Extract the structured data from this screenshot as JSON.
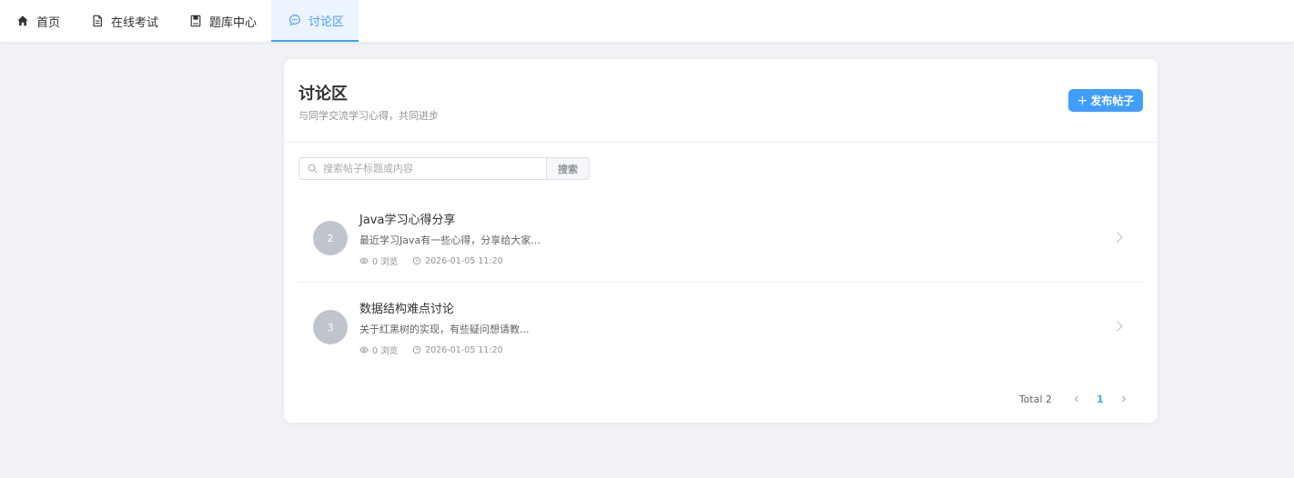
{
  "nav": {
    "items": [
      {
        "label": "首页",
        "icon": "home-icon",
        "active": false
      },
      {
        "label": "在线考试",
        "icon": "document-icon",
        "active": false
      },
      {
        "label": "题库中心",
        "icon": "notebook-icon",
        "active": false
      },
      {
        "label": "讨论区",
        "icon": "chat-bubble-icon",
        "active": true
      }
    ]
  },
  "header": {
    "title": "讨论区",
    "subtitle": "与同学交流学习心得，共同进步",
    "new_post_label": "发布帖子"
  },
  "search": {
    "placeholder": "搜索帖子标题或内容",
    "button_label": "搜索"
  },
  "posts": [
    {
      "avatar": "2",
      "title": "Java学习心得分享",
      "excerpt": "最近学习Java有一些心得，分享给大家...",
      "views": "0 浏览",
      "time": "2026-01-05 11:20"
    },
    {
      "avatar": "3",
      "title": "数据结构难点讨论",
      "excerpt": "关于红黑树的实现，有些疑问想请教...",
      "views": "0 浏览",
      "time": "2026-01-05 11:20"
    }
  ],
  "pagination": {
    "total_label": "Total 2",
    "current_page": "1"
  },
  "colors": {
    "accent": "#409eff",
    "background": "#f0f2f5",
    "avatar": "#c0c4cc"
  }
}
